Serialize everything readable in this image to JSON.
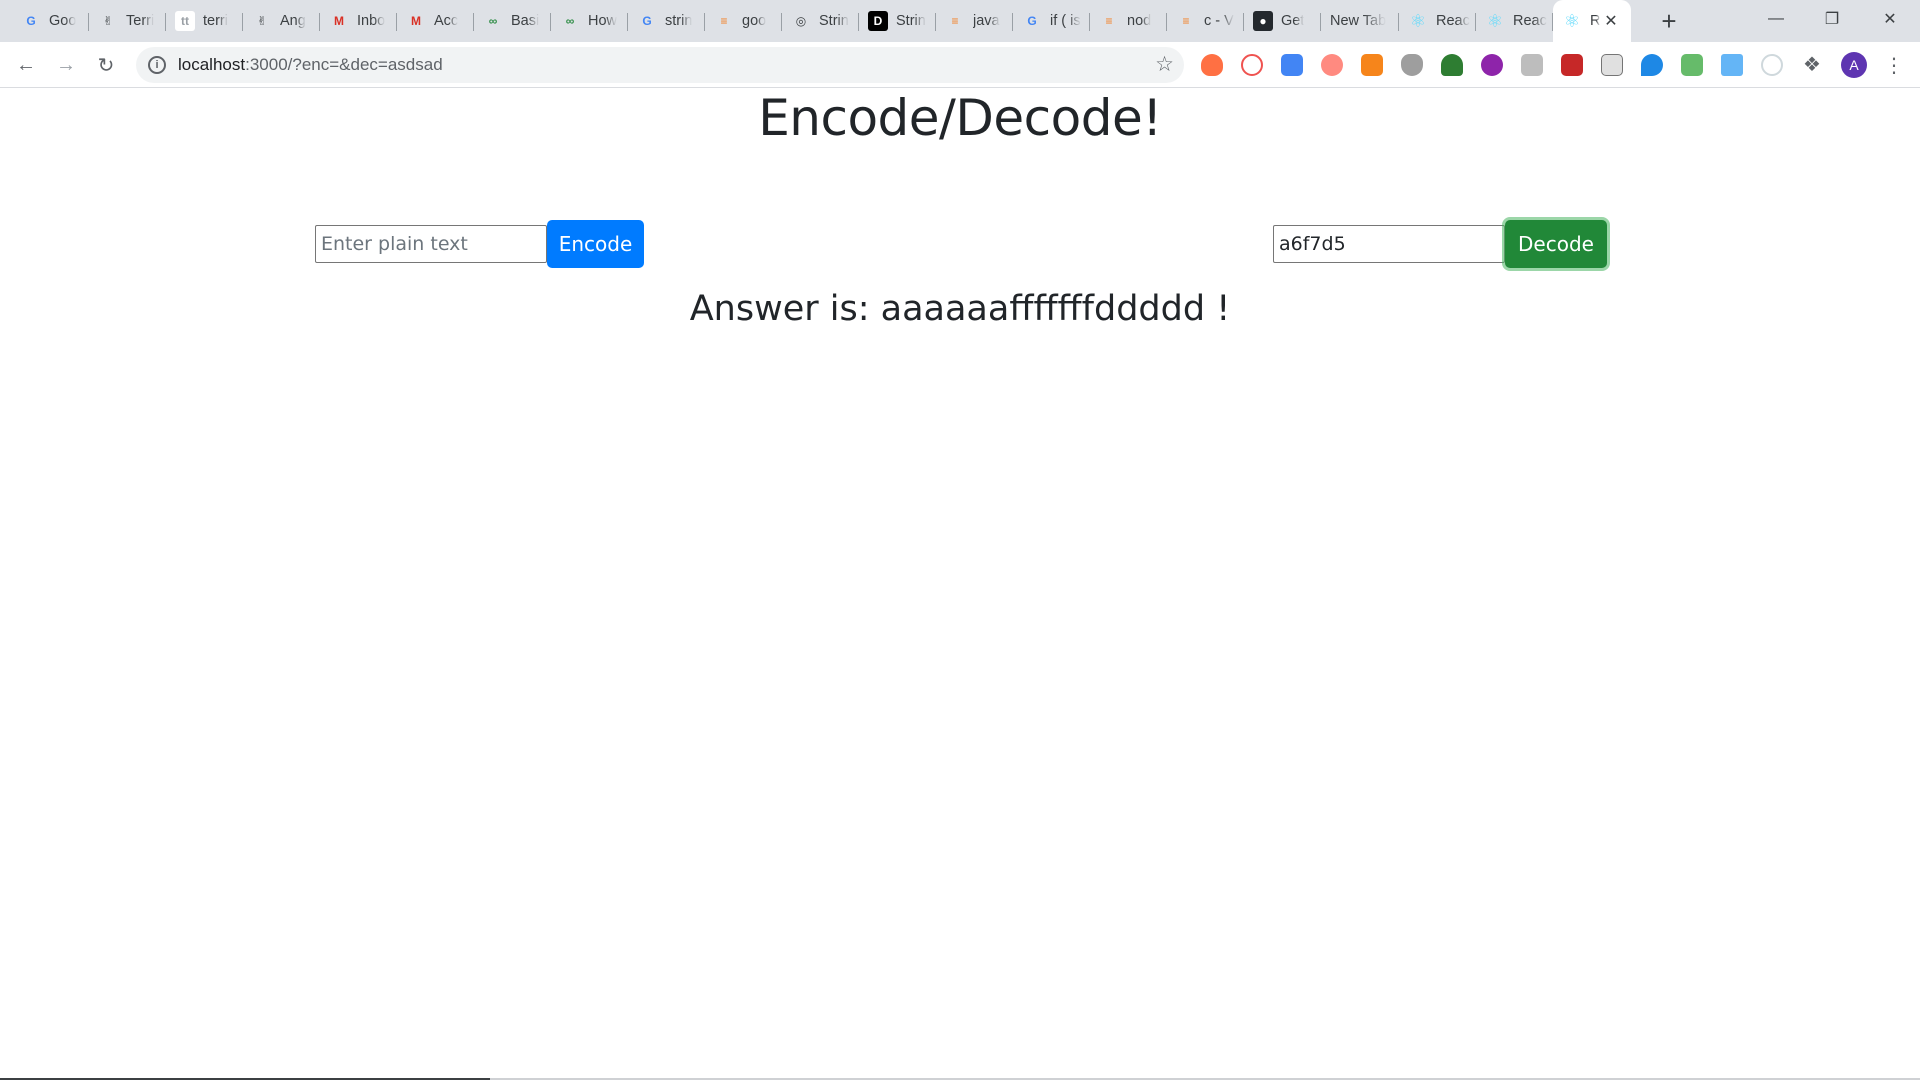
{
  "browser": {
    "tabs": [
      {
        "label": "Goo",
        "favicon": "google-icon"
      },
      {
        "label": "Terri",
        "favicon": "victory-hand-icon"
      },
      {
        "label": "terri",
        "favicon": "tt-icon"
      },
      {
        "label": "Ang",
        "favicon": "victory-hand-icon"
      },
      {
        "label": "Inbo",
        "favicon": "gmail-icon"
      },
      {
        "label": "Acc",
        "favicon": "gmail-icon"
      },
      {
        "label": "Basi",
        "favicon": "geeks-icon"
      },
      {
        "label": "How",
        "favicon": "geeks-icon"
      },
      {
        "label": "strin",
        "favicon": "google-icon"
      },
      {
        "label": "goo",
        "favicon": "stackoverflow-icon"
      },
      {
        "label": "Strin",
        "favicon": "globe-icon"
      },
      {
        "label": "Strin",
        "favicon": "dev-icon"
      },
      {
        "label": "java",
        "favicon": "stackoverflow-icon"
      },
      {
        "label": "if ( is",
        "favicon": "google-icon"
      },
      {
        "label": "nod",
        "favicon": "stackoverflow-icon"
      },
      {
        "label": "c - V",
        "favicon": "stackoverflow-icon"
      },
      {
        "label": "Get",
        "favicon": "github-icon"
      },
      {
        "label": "New Tab",
        "favicon": ""
      },
      {
        "label": "Reac",
        "favicon": "react-icon"
      },
      {
        "label": "Reac",
        "favicon": "react-icon"
      },
      {
        "label": "R",
        "favicon": "react-icon",
        "active": true
      }
    ],
    "new_tab_symbol": "+",
    "url_host": "localhost",
    "url_rest": ":3000/?enc=&dec=asdsad"
  },
  "page": {
    "title": "Encode/Decode!",
    "encode": {
      "placeholder": "Enter plain text",
      "value": "",
      "button_label": "Encode"
    },
    "decode": {
      "placeholder": "",
      "value": "a6f7d5",
      "button_label": "Decode"
    },
    "answer": "Answer is: aaaaaafffffffddddd !"
  },
  "colors": {
    "primary": "#007bff",
    "success": "#218838",
    "text": "#212529"
  }
}
